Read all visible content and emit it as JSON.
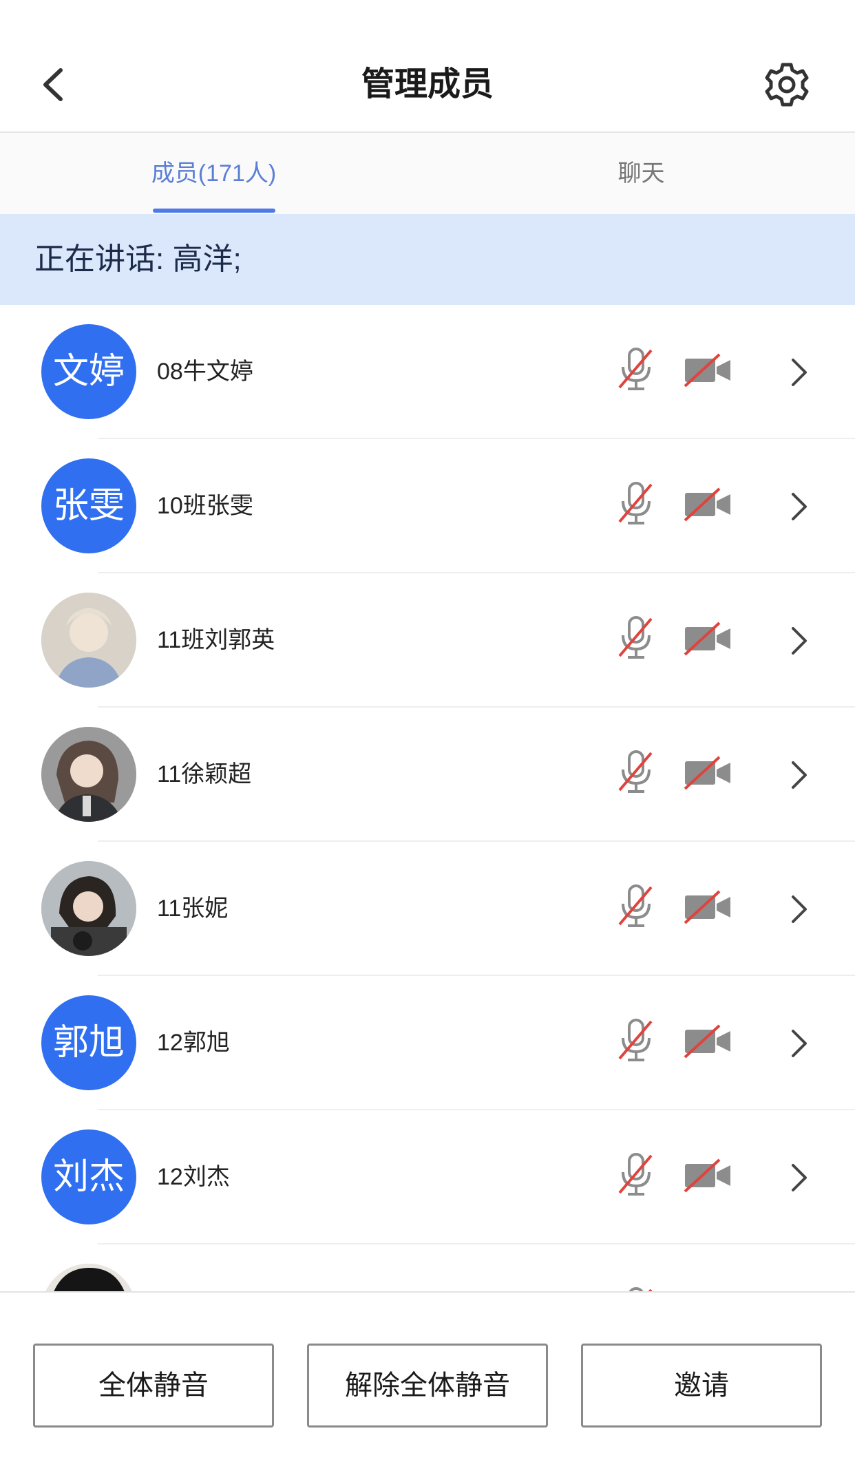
{
  "header": {
    "title": "管理成员"
  },
  "tabs": [
    {
      "label": "成员(171人)",
      "active": true
    },
    {
      "label": "聊天",
      "active": false
    }
  ],
  "speaking": {
    "text": "正在讲话: 高洋;"
  },
  "members": [
    {
      "name": "08牛文婷",
      "avatar_text": "文婷",
      "avatar_type": "text"
    },
    {
      "name": "10班张雯",
      "avatar_text": "张雯",
      "avatar_type": "text"
    },
    {
      "name": "11班刘郭英",
      "avatar_text": "",
      "avatar_type": "photo"
    },
    {
      "name": "11徐颖超",
      "avatar_text": "",
      "avatar_type": "photo"
    },
    {
      "name": "11张妮",
      "avatar_text": "",
      "avatar_type": "photo"
    },
    {
      "name": "12郭旭",
      "avatar_text": "郭旭",
      "avatar_type": "text"
    },
    {
      "name": "12刘杰",
      "avatar_text": "刘杰",
      "avatar_type": "text"
    },
    {
      "name": "",
      "avatar_text": "",
      "avatar_type": "photo"
    }
  ],
  "footer": {
    "mute_all": "全体静音",
    "unmute_all": "解除全体静音",
    "invite": "邀请"
  },
  "colors": {
    "accent": "#4f79e6",
    "avatar_bg": "#2f6ff0",
    "speaking_bg": "#dbe7fb",
    "muted_slash": "#e0423c"
  },
  "icons": [
    "back-arrow-icon",
    "gear-icon",
    "mic-muted-icon",
    "camera-off-icon",
    "chevron-right-icon"
  ]
}
